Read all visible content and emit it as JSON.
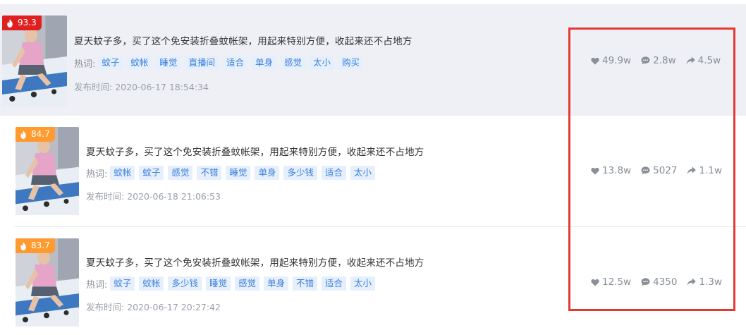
{
  "colors": {
    "badge_red": "#e02020",
    "badge_orange": "#ff9a2e",
    "tag_text": "#3b7ddd",
    "tag_bg": "#e6f0fc",
    "highlight_row": "#eef0f5",
    "annotation_box": "#e53935"
  },
  "icons": {
    "score": "fire-icon",
    "likes": "heart-icon",
    "comments": "comment-icon",
    "shares": "share-icon"
  },
  "tags_label": "热词:",
  "pubtime_label": "发布时间:",
  "items": [
    {
      "score": "93.3",
      "title": "夏天蚊子多，买了这个免安装折叠蚊帐架，用起来特别方便，收起来还不占地方",
      "tags": [
        "蚊子",
        "蚊帐",
        "睡觉",
        "直播间",
        "适合",
        "单身",
        "感觉",
        "太小",
        "购买"
      ],
      "pubtime": "2020-06-17 18:54:34",
      "likes": "49.9w",
      "comments": "2.8w",
      "shares": "4.5w"
    },
    {
      "score": "84.7",
      "title": "夏天蚊子多，买了这个免安装折叠蚊帐架，用起来特别方便，收起来还不占地方",
      "tags": [
        "蚊帐",
        "蚊子",
        "感觉",
        "不错",
        "睡觉",
        "单身",
        "多少钱",
        "适合",
        "太小"
      ],
      "pubtime": "2020-06-18 21:06:53",
      "likes": "13.8w",
      "comments": "5027",
      "shares": "1.1w"
    },
    {
      "score": "83.7",
      "title": "夏天蚊子多，买了这个免安装折叠蚊帐架，用起来特别方便，收起来还不占地方",
      "tags": [
        "蚊子",
        "蚊帐",
        "多少钱",
        "睡觉",
        "感觉",
        "单身",
        "不错",
        "适合",
        "太小"
      ],
      "pubtime": "2020-06-17 20:27:42",
      "likes": "12.5w",
      "comments": "4350",
      "shares": "1.3w"
    }
  ]
}
